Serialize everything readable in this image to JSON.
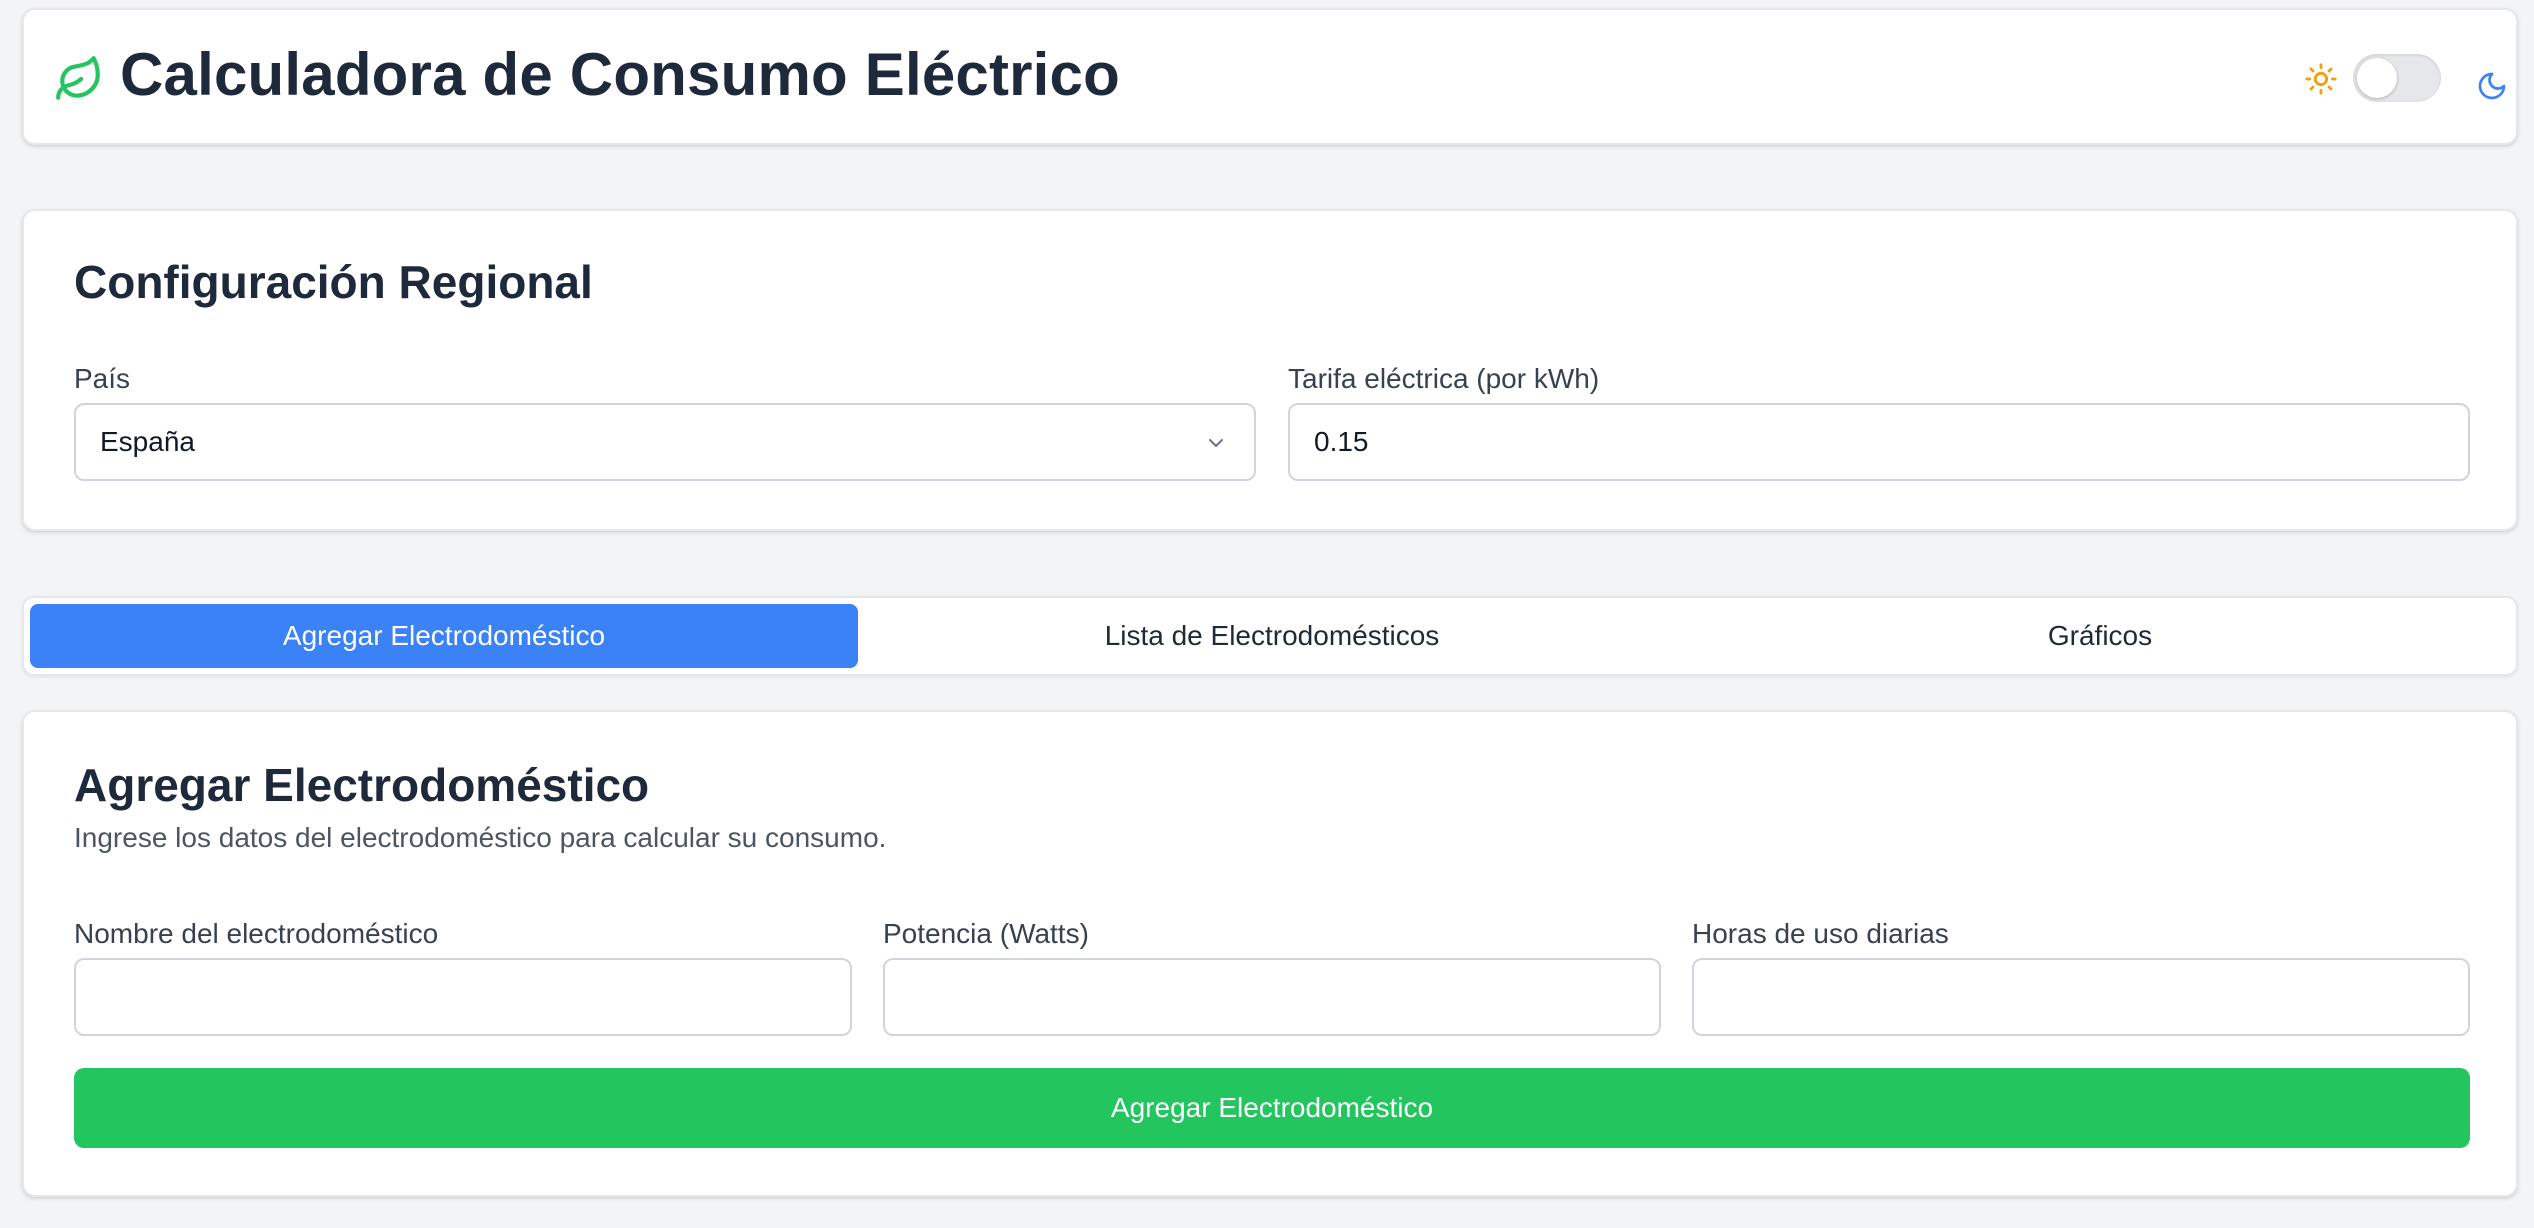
{
  "header": {
    "title": "Calculadora de Consumo Eléctrico",
    "logo_icon": "leaf-icon",
    "theme_toggle": {
      "light_icon": "sun-icon",
      "dark_icon": "moon-icon",
      "dark_mode": false
    }
  },
  "regional": {
    "title": "Configuración Regional",
    "country_label": "País",
    "country_value": "España",
    "tariff_label": "Tarifa eléctrica (por kWh)",
    "tariff_value": "0.15"
  },
  "tabs": [
    {
      "label": "Agregar Electrodoméstico",
      "active": true
    },
    {
      "label": "Lista de Electrodomésticos",
      "active": false
    },
    {
      "label": "Gráficos",
      "active": false
    }
  ],
  "add_appliance": {
    "title": "Agregar Electrodoméstico",
    "description": "Ingrese los datos del electrodoméstico para calcular su consumo.",
    "name_label": "Nombre del electrodoméstico",
    "name_value": "",
    "power_label": "Potencia (Watts)",
    "power_value": "",
    "hours_label": "Horas de uso diarias",
    "hours_value": "",
    "submit_label": "Agregar Electrodoméstico"
  },
  "colors": {
    "accent_blue": "#3b82f6",
    "accent_green": "#22c55e",
    "leaf_green": "#22c55e",
    "sun_amber": "#f59e0b",
    "moon_blue": "#3b82f6",
    "background": "#f3f4f6"
  }
}
